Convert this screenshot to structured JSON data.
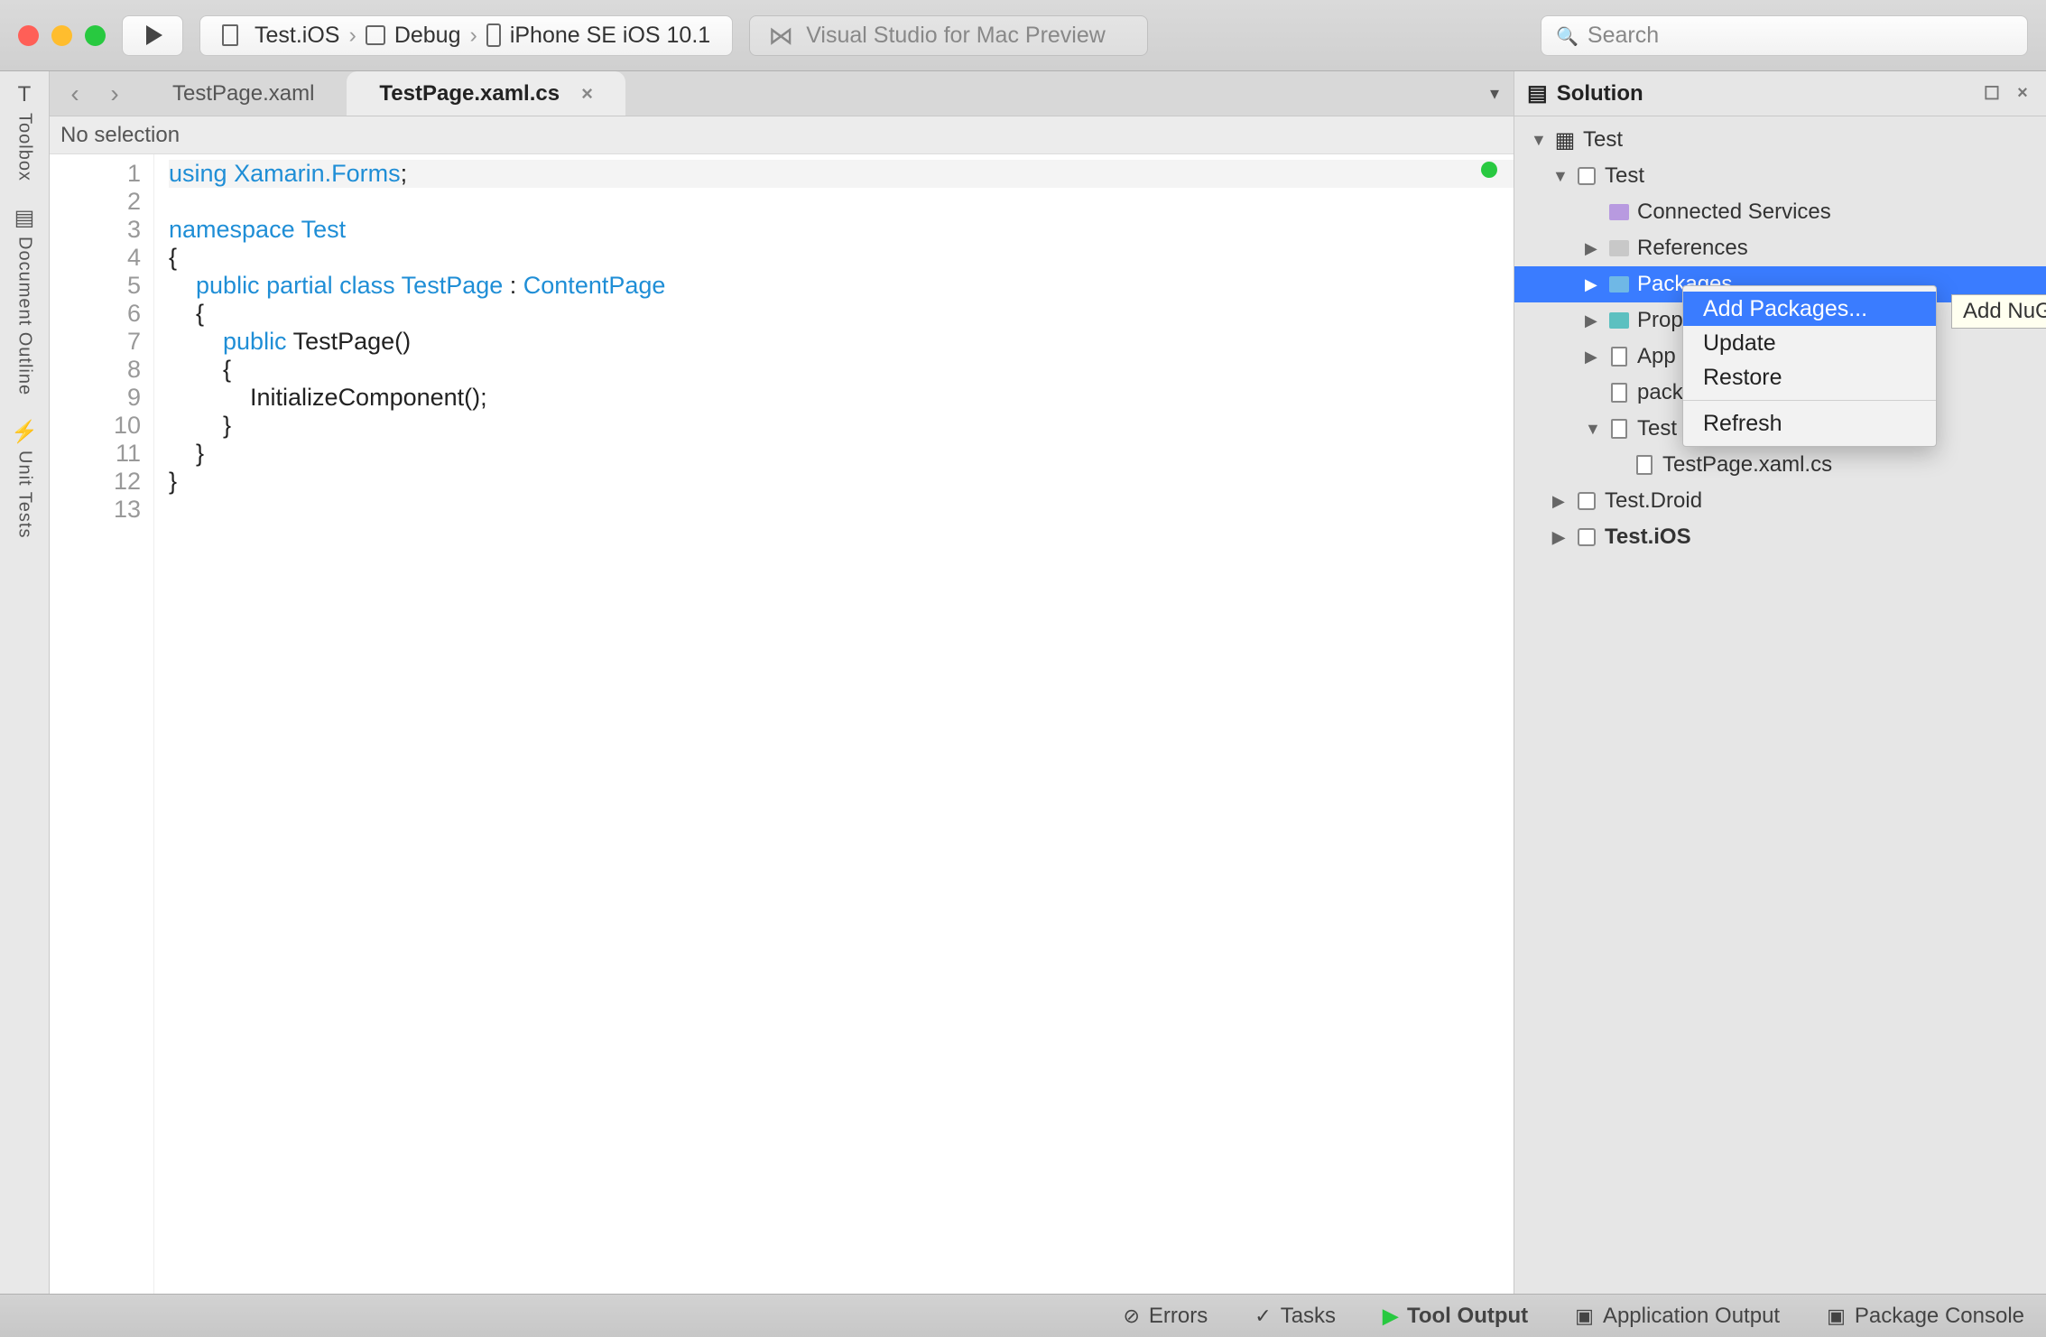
{
  "toolbar": {
    "build": {
      "project": "Test.iOS",
      "config": "Debug",
      "device": "iPhone SE iOS 10.1"
    },
    "status_text": "Visual Studio for Mac Preview",
    "search_placeholder": "Search"
  },
  "left_rail": {
    "items": [
      "Toolbox",
      "Document Outline",
      "Unit Tests"
    ]
  },
  "tabs": {
    "inactive": "TestPage.xaml",
    "active": "TestPage.xaml.cs"
  },
  "crumb": "No selection",
  "code": {
    "lines": [
      {
        "n": 1,
        "tokens": [
          [
            "kw",
            "using"
          ],
          [
            "",
            ""
          ],
          [
            "type",
            "Xamarin.Forms"
          ],
          [
            "",
            ";"
          ]
        ]
      },
      {
        "n": 2,
        "tokens": []
      },
      {
        "n": 3,
        "tokens": [
          [
            "kw",
            "namespace"
          ],
          [
            "",
            ""
          ],
          [
            "type",
            "Test"
          ]
        ]
      },
      {
        "n": 4,
        "tokens": [
          [
            "",
            "{"
          ]
        ]
      },
      {
        "n": 5,
        "tokens": [
          [
            "",
            "    "
          ],
          [
            "kw",
            "public"
          ],
          [
            "",
            ""
          ],
          [
            "kw",
            "partial"
          ],
          [
            "",
            ""
          ],
          [
            "kw",
            "class"
          ],
          [
            "",
            ""
          ],
          [
            "type",
            "TestPage"
          ],
          [
            "",
            ""
          ],
          [
            "",
            ": "
          ],
          [
            "type",
            "ContentPage"
          ]
        ]
      },
      {
        "n": 6,
        "tokens": [
          [
            "",
            "    {"
          ]
        ]
      },
      {
        "n": 7,
        "tokens": [
          [
            "",
            "        "
          ],
          [
            "kw",
            "public"
          ],
          [
            "",
            ""
          ],
          [
            "",
            "TestPage()"
          ]
        ]
      },
      {
        "n": 8,
        "tokens": [
          [
            "",
            "        {"
          ]
        ]
      },
      {
        "n": 9,
        "tokens": [
          [
            "",
            "            InitializeComponent();"
          ]
        ]
      },
      {
        "n": 10,
        "tokens": [
          [
            "",
            "        }"
          ]
        ]
      },
      {
        "n": 11,
        "tokens": [
          [
            "",
            "    }"
          ]
        ]
      },
      {
        "n": 12,
        "tokens": [
          [
            "",
            "}"
          ]
        ]
      },
      {
        "n": 13,
        "tokens": []
      }
    ]
  },
  "solution": {
    "title": "Solution",
    "root": "Test",
    "project": "Test",
    "nodes": {
      "connected": "Connected Services",
      "references": "References",
      "packages": "Packages",
      "prop": "Prop",
      "app": "App",
      "pack": "pack",
      "test": "Test",
      "testpage": "TestPage.xaml.cs",
      "droid": "Test.Droid",
      "ios": "Test.iOS"
    }
  },
  "context_menu": {
    "add_packages": "Add Packages...",
    "update": "Update",
    "restore": "Restore",
    "refresh": "Refresh",
    "tooltip": "Add NuGe"
  },
  "bottom_bar": {
    "errors": "Errors",
    "tasks": "Tasks",
    "tool_output": "Tool Output",
    "app_output": "Application Output",
    "pkg_console": "Package Console"
  }
}
